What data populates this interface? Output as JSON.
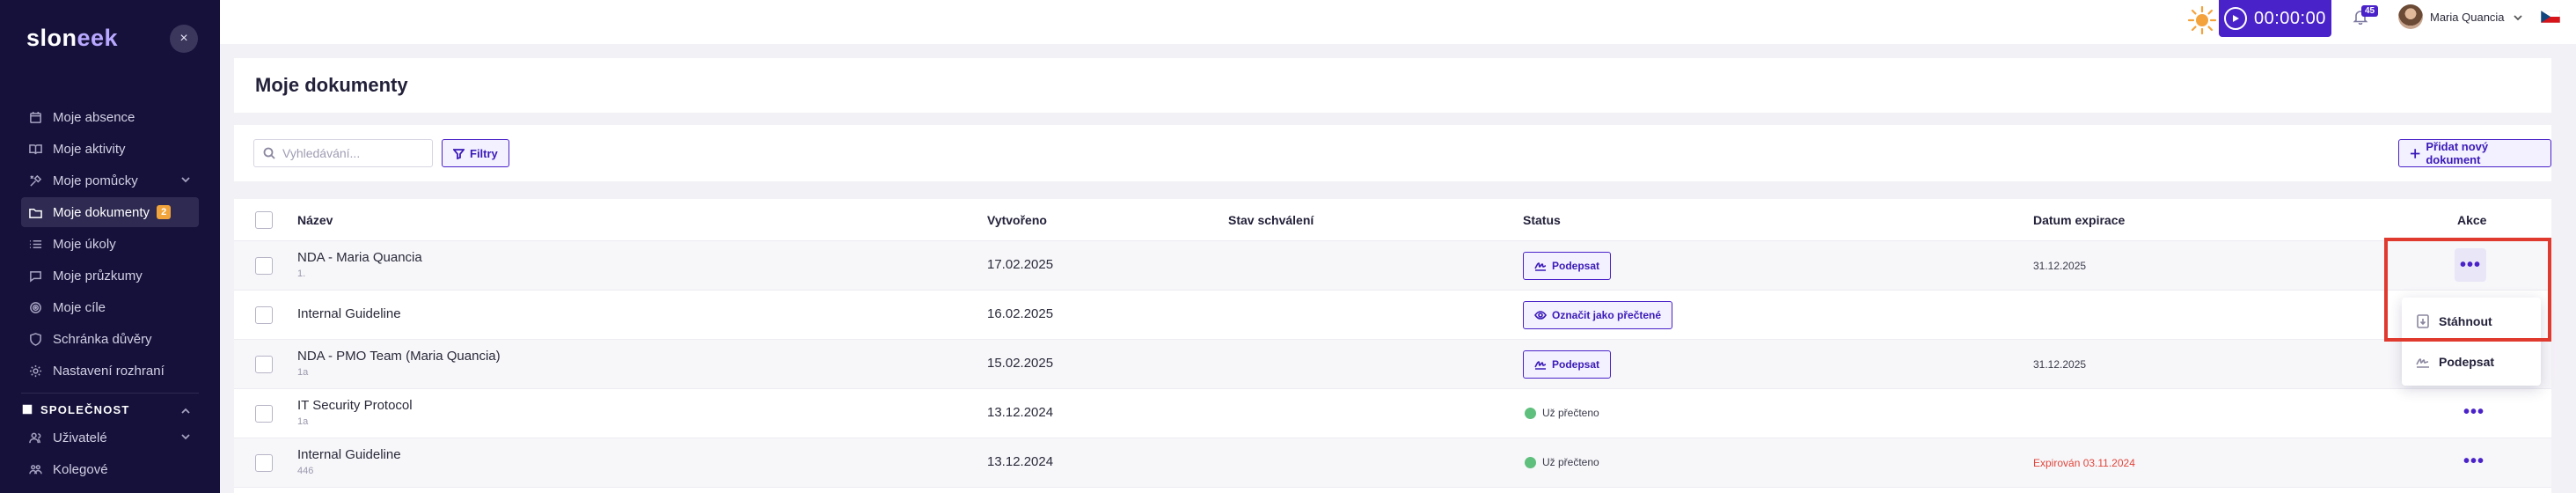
{
  "brand": {
    "logo_main": "slon",
    "logo_accent": "eek",
    "close_glyph": "×"
  },
  "sidebar": {
    "items": [
      {
        "label": "Moje absence",
        "icon": "calendar-icon"
      },
      {
        "label": "Moje aktivity",
        "icon": "book-icon"
      },
      {
        "label": "Moje pomůcky",
        "icon": "tools-icon",
        "chevron": true
      },
      {
        "label": "Moje dokumenty",
        "icon": "folder-icon",
        "badge": "2",
        "active": true
      },
      {
        "label": "Moje úkoly",
        "icon": "list-icon"
      },
      {
        "label": "Moje průzkumy",
        "icon": "chat-icon"
      },
      {
        "label": "Moje cíle",
        "icon": "target-icon"
      },
      {
        "label": "Schránka důvěry",
        "icon": "shield-icon"
      },
      {
        "label": "Nastavení rozhraní",
        "icon": "gear-icon"
      }
    ],
    "section": {
      "label": "SPOLEČNOST",
      "icon": "building-icon"
    },
    "section_items": [
      {
        "label": "Uživatelé",
        "icon": "users-icon",
        "chevron": true
      },
      {
        "label": "Kolegové",
        "icon": "people-icon"
      }
    ]
  },
  "topbar": {
    "timer": "00:00:00",
    "notifications_count": "45",
    "user_name": "Maria Quancia",
    "accent": "#4a22c9"
  },
  "page": {
    "title": "Moje dokumenty",
    "search_placeholder": "Vyhledávání...",
    "filters_label": "Filtry",
    "add_label": "Přidat nový dokument"
  },
  "table": {
    "headers": {
      "name": "Název",
      "created": "Vytvořeno",
      "approval": "Stav schválení",
      "status": "Status",
      "expiry": "Datum expirace",
      "actions": "Akce"
    },
    "rows": [
      {
        "name": "NDA - Maria Quancia",
        "sub": "1.",
        "created": "17.02.2025",
        "status_type": "button",
        "status": "Podepsat",
        "status_icon": "signature-icon",
        "expiry": "31.12.2025",
        "expiry_red": false
      },
      {
        "name": "Internal Guideline",
        "sub": "",
        "created": "16.02.2025",
        "status_type": "button",
        "status": "Označit jako přečtené",
        "status_icon": "eye-icon",
        "expiry": "",
        "expiry_red": false
      },
      {
        "name": "NDA - PMO Team (Maria Quancia)",
        "sub": "1a",
        "created": "15.02.2025",
        "status_type": "button",
        "status": "Podepsat",
        "status_icon": "signature-icon",
        "expiry": "31.12.2025",
        "expiry_red": false
      },
      {
        "name": "IT Security Protocol",
        "sub": "1a",
        "created": "13.12.2024",
        "status_type": "read",
        "status": "Už přečteno",
        "expiry": "",
        "expiry_red": false
      },
      {
        "name": "Internal Guideline",
        "sub": "446",
        "created": "13.12.2024",
        "status_type": "read",
        "status": "Už přečteno",
        "expiry": "Expirován 03.11.2024",
        "expiry_red": true
      }
    ]
  },
  "dropdown": {
    "items": [
      {
        "label": "Stáhnout",
        "icon": "download-icon"
      },
      {
        "label": "Podepsat",
        "icon": "signature-icon"
      }
    ]
  },
  "dots_glyph": "•••"
}
